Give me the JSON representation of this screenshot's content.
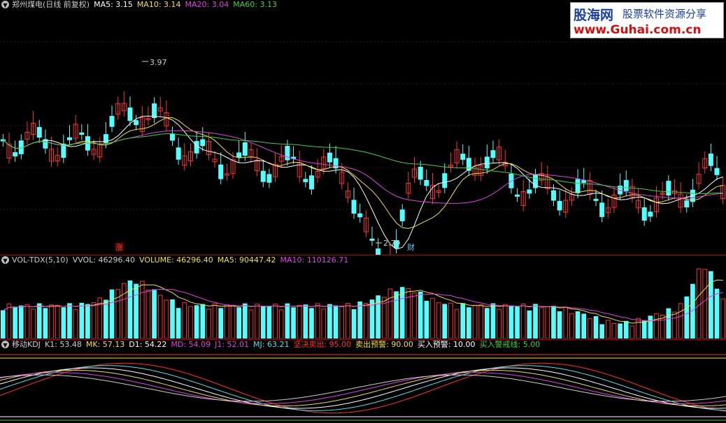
{
  "main": {
    "title": "郑州煤电(日线 前复权)",
    "ma": [
      {
        "label": "MA5: 3.15",
        "color": "#ffffff"
      },
      {
        "label": "MA10: 3.14",
        "color": "#f0e040"
      },
      {
        "label": "MA20: 3.04",
        "color": "#e040e0"
      },
      {
        "label": "MA60: 3.13",
        "color": "#40d040"
      }
    ],
    "high_label": "3.97",
    "low_label": "2.79",
    "badge_zhang": "涨",
    "badge_cai": "财"
  },
  "volume": {
    "title": "VOL-TDX(5,10)",
    "items": [
      {
        "label": "VVOL: 46296.40",
        "color": "#cccccc"
      },
      {
        "label": "VOLUME: 46296.40",
        "color": "#f0e040"
      },
      {
        "label": "MA5: 90447.42",
        "color": "#f0e040"
      },
      {
        "label": "MA10: 110126.71",
        "color": "#e040e0"
      }
    ]
  },
  "kdj": {
    "title": "移动KDJ",
    "items": [
      {
        "label": "K1: 53.48",
        "color": "#cccccc"
      },
      {
        "label": "MK: 57.13",
        "color": "#f0e040"
      },
      {
        "label": "D1: 54.22",
        "color": "#ffffff"
      },
      {
        "label": "MD: 54.09",
        "color": "#e040e0"
      },
      {
        "label": "J1: 52.01",
        "color": "#e040e0"
      },
      {
        "label": "MJ: 63.21",
        "color": "#50e0f0"
      },
      {
        "label": "坚决卖出: 95.00",
        "color": "#ff3030"
      },
      {
        "label": "卖出预警: 90.00",
        "color": "#f0e040"
      },
      {
        "label": "买入预警: 10.00",
        "color": "#ffffff"
      },
      {
        "label": "买入警戒线: 5.00",
        "color": "#40d040"
      }
    ]
  },
  "logo": {
    "brand": "股海网",
    "tagline": "股票软件资源分享",
    "url": "www.Guhai.com.cn"
  },
  "colors": {
    "up": "#ff3232",
    "down": "#54ffff",
    "background": "#000000"
  },
  "icons": [
    "dropdown-icon"
  ]
}
